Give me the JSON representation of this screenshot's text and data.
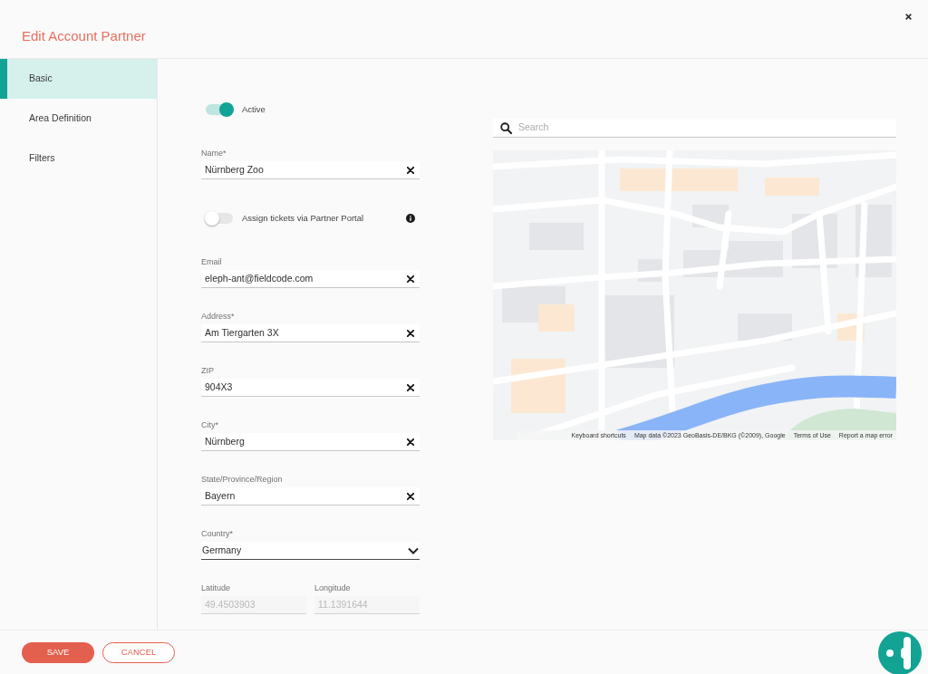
{
  "dialog": {
    "title": "Edit Account Partner"
  },
  "sidebar": {
    "items": [
      {
        "label": "Basic",
        "selected": true
      },
      {
        "label": "Area Definition",
        "selected": false
      },
      {
        "label": "Filters",
        "selected": false
      }
    ]
  },
  "form": {
    "rows": [
      {
        "kind": "toggle",
        "label": "Active",
        "on": true
      },
      {
        "kind": "text",
        "label": "Name*",
        "value": "Nürnberg Zoo"
      },
      {
        "kind": "toggle",
        "label": "Assign tickets via Partner Portal",
        "on": false,
        "info": true
      },
      {
        "kind": "text",
        "label": "Email",
        "value": "eleph-ant@fieldcode.com"
      },
      {
        "kind": "text",
        "label": "Address*",
        "value": "Am Tiergarten 3X"
      },
      {
        "kind": "text",
        "label": "ZIP",
        "value": "904X3"
      },
      {
        "kind": "text",
        "label": "City*",
        "value": "Nürnberg"
      },
      {
        "kind": "text",
        "label": "State/Province/Region",
        "value": "Bayern"
      },
      {
        "kind": "select",
        "label": "Country*",
        "value": "Germany"
      },
      {
        "kind": "pair",
        "fields": [
          {
            "label": "Latitude",
            "value": "49.4503903",
            "disabled": true
          },
          {
            "label": "Longitude",
            "value": "11.1391644",
            "disabled": true
          }
        ]
      }
    ]
  },
  "map": {
    "search": {
      "placeholder": "Search"
    },
    "attribution": {
      "keyboard_shortcuts": "Keyboard shortcuts",
      "map_data": "Map data ©2023 GeoBasis-DE/BKG (©2009), Google",
      "terms": "Terms of Use",
      "report": "Report a map error"
    }
  },
  "footer": {
    "buttons": [
      {
        "label": "SAVE",
        "kind": "primary"
      },
      {
        "label": "CANCEL",
        "kind": "secondary"
      }
    ]
  }
}
